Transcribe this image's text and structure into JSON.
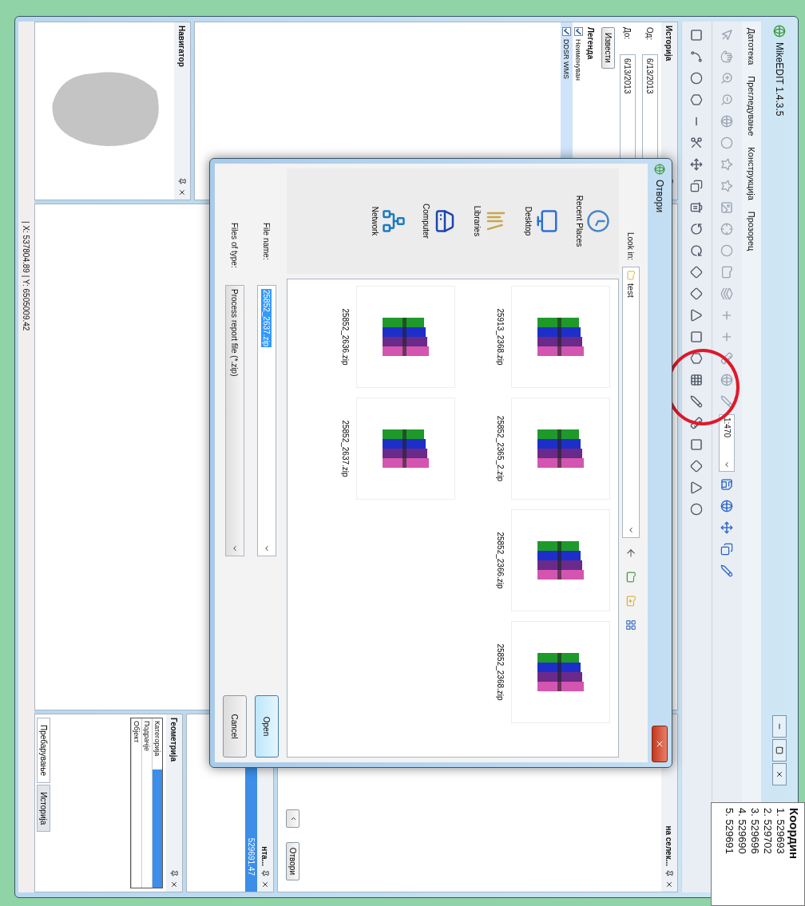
{
  "window": {
    "title": "MikeEDIT 1.4.3.5"
  },
  "menu": [
    "Датотека",
    "Прегледување",
    "Конструкција",
    "Прозорец"
  ],
  "toolbar": {
    "scale": "1:470"
  },
  "history_panel": {
    "title": "Историја",
    "from_label": "Од:",
    "from": "6/13/2013",
    "to_label": "До:",
    "to": "6/13/2013",
    "report_button": "Извести"
  },
  "legend": {
    "title": "Легенда",
    "layers": [
      {
        "name": "Неименуван",
        "checked": true,
        "selected": false
      },
      {
        "name": "DDSR WMS",
        "checked": true,
        "selected": true
      }
    ]
  },
  "navigator": {
    "title": "Навигатор"
  },
  "status_bar": {
    "coordinates": "| X: 537804.89 | Y: 6505009.42"
  },
  "selection_panel": {
    "title": "на селек...",
    "button": "Отвори"
  },
  "vertex_panel": {
    "title": "нта...",
    "rows": [
      {
        "text": "529691.47",
        "selected": true
      }
    ]
  },
  "geometry_panel": {
    "title": "Геометрија",
    "rows": [
      {
        "label": "Категорија",
        "selected": true
      },
      {
        "label": "Подрачје",
        "selected": false
      },
      {
        "label": "Објект",
        "selected": false
      }
    ]
  },
  "bottom_tabs": [
    {
      "label": "Пребарување",
      "selected": true
    },
    {
      "label": "Историја",
      "selected": false
    }
  ],
  "coordinates_popup": {
    "title": "Координ",
    "points": [
      "1. 529693",
      "2. 529702",
      "3. 529696",
      "4. 529690",
      "5. 529691"
    ]
  },
  "dialog": {
    "title": "Отвори",
    "look_in_label": "Look in:",
    "look_in": "test",
    "places": [
      "Recent Places",
      "Desktop",
      "Libraries",
      "Computer",
      "Network"
    ],
    "files": [
      "25913_2368.zip",
      "25852_2365_2.zip",
      "25852_2366.zip",
      "25852_2368.zip",
      "25852_2636.zip",
      "25852_2637.zip"
    ],
    "file_name_label": "File name:",
    "file_name": "25852_2637.zip",
    "file_type_label": "Files of type:",
    "file_type": "Process report file (*.zip)",
    "buttons": [
      "Open",
      "Cancel"
    ]
  }
}
